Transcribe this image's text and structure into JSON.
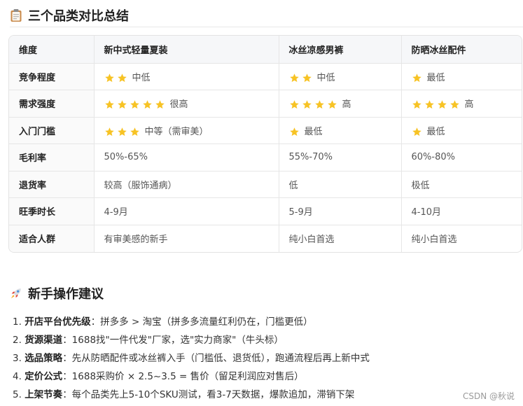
{
  "section1": {
    "title": "三个品类对比总结",
    "icon": "clipboard-icon"
  },
  "table": {
    "headers": [
      "维度",
      "新中式轻量夏装",
      "冰丝凉感男裤",
      "防晒冰丝配件"
    ],
    "rows": [
      {
        "label": "竞争程度",
        "cells": [
          {
            "stars": 2,
            "text": "中低"
          },
          {
            "stars": 2,
            "text": "中低"
          },
          {
            "stars": 1,
            "text": "最低"
          }
        ]
      },
      {
        "label": "需求强度",
        "cells": [
          {
            "stars": 5,
            "text": "很高"
          },
          {
            "stars": 4,
            "text": "高"
          },
          {
            "stars": 4,
            "text": "高"
          }
        ]
      },
      {
        "label": "入门门槛",
        "cells": [
          {
            "stars": 3,
            "text": "中等（需审美）"
          },
          {
            "stars": 1,
            "text": "最低"
          },
          {
            "stars": 1,
            "text": "最低"
          }
        ]
      },
      {
        "label": "毛利率",
        "cells": [
          {
            "stars": 0,
            "text": "50%-65%"
          },
          {
            "stars": 0,
            "text": "55%-70%"
          },
          {
            "stars": 0,
            "text": "60%-80%"
          }
        ]
      },
      {
        "label": "退货率",
        "cells": [
          {
            "stars": 0,
            "text": "较高（服饰通病）"
          },
          {
            "stars": 0,
            "text": "低"
          },
          {
            "stars": 0,
            "text": "极低"
          }
        ]
      },
      {
        "label": "旺季时长",
        "cells": [
          {
            "stars": 0,
            "text": "4-9月"
          },
          {
            "stars": 0,
            "text": "5-9月"
          },
          {
            "stars": 0,
            "text": "4-10月"
          }
        ]
      },
      {
        "label": "适合人群",
        "cells": [
          {
            "stars": 0,
            "text": "有审美感的新手"
          },
          {
            "stars": 0,
            "text": "纯小白首选"
          },
          {
            "stars": 0,
            "text": "纯小白首选"
          }
        ]
      }
    ],
    "star_color": "#f7c325"
  },
  "section2": {
    "title": "新手操作建议",
    "icon": "rocket-icon"
  },
  "tips": [
    {
      "num": "1.",
      "key": "开店平台优先级",
      "text": "：拼多多 > 淘宝（拼多多流量红利仍在，门槛更低）"
    },
    {
      "num": "2.",
      "key": "货源渠道",
      "text": "：1688找\"一件代发\"厂家，选\"实力商家\"（牛头标）"
    },
    {
      "num": "3.",
      "key": "选品策略",
      "text": "：先从防晒配件或冰丝裤入手（门槛低、退货低），跑通流程后再上新中式"
    },
    {
      "num": "4.",
      "key": "定价公式",
      "text": "：1688采购价 × 2.5~3.5 = 售价（留足利润应对售后）"
    },
    {
      "num": "5.",
      "key": "上架节奏",
      "text": "：每个品类先上5-10个SKU测试，看3-7天数据，爆款追加，滞销下架"
    }
  ],
  "watermark": "CSDN @秋说"
}
